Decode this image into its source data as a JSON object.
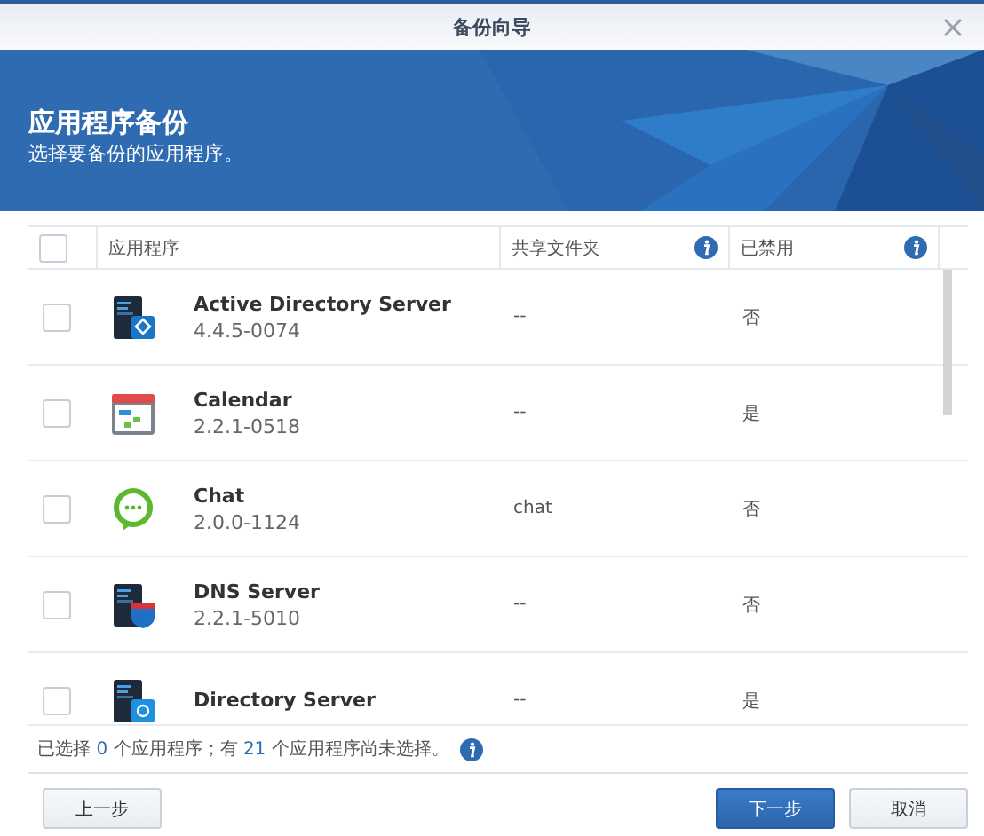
{
  "window": {
    "title": "备份向导"
  },
  "banner": {
    "title": "应用程序备份",
    "subtitle": "选择要备份的应用程序。"
  },
  "table": {
    "all_checked": false,
    "columns": [
      {
        "label": "应用程序",
        "info": false
      },
      {
        "label": "共享文件夹",
        "info": true
      },
      {
        "label": "已禁用",
        "info": true
      }
    ],
    "rows": [
      {
        "kind": "directory-server",
        "name": "Active Directory Server",
        "version": "4.4.5-0074",
        "shared": "--",
        "disabled": "否",
        "checked": false
      },
      {
        "kind": "calendar",
        "name": "Calendar",
        "version": "2.2.1-0518",
        "shared": "--",
        "disabled": "是",
        "checked": false
      },
      {
        "kind": "chat",
        "name": "Chat",
        "version": "2.0.0-1124",
        "shared": "chat",
        "disabled": "否",
        "checked": false
      },
      {
        "kind": "dns",
        "name": "DNS Server",
        "version": "2.2.1-5010",
        "shared": "--",
        "disabled": "否",
        "checked": false
      },
      {
        "kind": "directory",
        "name": "Directory Server",
        "shared": "--",
        "disabled": "是",
        "checked": false
      }
    ]
  },
  "status": {
    "before": "已选择",
    "selected": "0",
    "middle": "个应用程序；有",
    "unselected": "21",
    "after": "个应用程序尚未选择。"
  },
  "buttons": [
    {
      "label": "上一步",
      "kind": "default"
    },
    {
      "label": "下一步",
      "kind": "primary"
    },
    {
      "label": "取消",
      "kind": "default"
    }
  ]
}
